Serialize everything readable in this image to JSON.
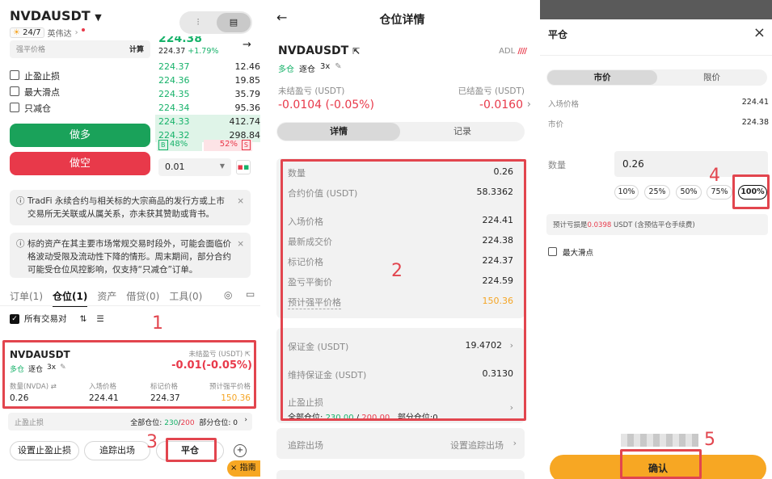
{
  "annotations": [
    "1",
    "2",
    "3",
    "4",
    "5"
  ],
  "panel1": {
    "symbol": "NVDAUSDT",
    "badge_247": "24/7",
    "underlying": "英伟达",
    "price_big": "224.38",
    "price_sub": "224.37",
    "price_pct": "+1.79%",
    "force_price_label": "强平价格",
    "calc_label": "计算",
    "checkboxes": [
      "止盈止损",
      "最大滑点",
      "只减仓"
    ],
    "buy_button": "做多",
    "sell_button": "做空",
    "orderbook": [
      {
        "price": "224.37",
        "qty": "12.46"
      },
      {
        "price": "224.36",
        "qty": "19.85"
      },
      {
        "price": "224.35",
        "qty": "35.79"
      },
      {
        "price": "224.34",
        "qty": "95.36"
      },
      {
        "price": "224.33",
        "qty": "412.74"
      },
      {
        "price": "224.32",
        "qty": "298.84"
      }
    ],
    "buy_ratio_tag": "B",
    "buy_ratio": "48%",
    "sell_ratio": "52%",
    "sell_ratio_tag": "S",
    "precision": "0.01",
    "notice1": "TradFi 永续合约与相关标的大宗商品的发行方或上市交易所无关联或从属关系，亦未获其赞助或背书。",
    "notice2": "标的资产在其主要市场常规交易时段外，可能会面临价格波动受限及流动性下降的情形。周末期间，部分合约可能受仓位风控影响，仅支持“只减仓”订单。",
    "tabs": [
      "订单(1)",
      "仓位(1)",
      "资产",
      "借贷(0)",
      "工具(0)"
    ],
    "all_pairs": "所有交易对",
    "position": {
      "symbol": "NVDAUSDT",
      "side": "多仓",
      "mode": "逐仓",
      "leverage": "3x",
      "unrealized_label": "未结盈亏 (USDT)",
      "unrealized": "-0.01(-0.05%)",
      "col_labels": [
        "数量(NVDA)",
        "入场价格",
        "标记价格",
        "预计强平价格"
      ],
      "col_values": [
        "0.26",
        "224.41",
        "224.37",
        "150.36"
      ]
    },
    "tpsl_label": "止盈止损",
    "tpsl_all_label": "全部仓位:",
    "tpsl_all_green": "230",
    "tpsl_all_red": "200",
    "tpsl_part": "部分仓位: 0",
    "btn_set_tpsl": "设置止盈止损",
    "btn_trailing": "追踪出场",
    "btn_close": "平仓",
    "guide": "指南"
  },
  "panel2": {
    "title": "仓位详情",
    "symbol": "NVDAUSDT",
    "adl_label": "ADL",
    "side": "多仓",
    "mode": "逐仓",
    "leverage": "3x",
    "unrealized_label": "未结盈亏 (USDT)",
    "unrealized": "-0.0104 (-0.05%)",
    "realized_label": "已结盈亏 (USDT)",
    "realized": "-0.0160",
    "tabs": [
      "详情",
      "记录"
    ],
    "rows": [
      {
        "label": "数量",
        "value": "0.26"
      },
      {
        "label": "合约价值 (USDT)",
        "value": "58.3362"
      },
      {
        "label": "入场价格",
        "value": "224.41"
      },
      {
        "label": "最新成交价",
        "value": "224.38"
      },
      {
        "label": "标记价格",
        "value": "224.37"
      },
      {
        "label": "盈亏平衡价",
        "value": "224.59"
      },
      {
        "label": "预计强平价格",
        "value": "150.36"
      }
    ],
    "margin_label": "保证金 (USDT)",
    "margin_value": "19.4702",
    "maint_label": "维持保证金 (USDT)",
    "maint_value": "0.3130",
    "tpsl_label": "止盈止损",
    "tpsl_all_label": "全部仓位:",
    "tpsl_all_green": "230.00",
    "tpsl_all_red": "200.00",
    "tpsl_part": "部分仓位:0",
    "trailing_label": "追踪出场",
    "trailing_action": "设置追踪出场"
  },
  "panel3": {
    "title": "平仓",
    "tabs": [
      "市价",
      "限价"
    ],
    "entry_label": "入场价格",
    "entry_value": "224.41",
    "market_label": "市价",
    "market_value": "224.38",
    "qty_label": "数量",
    "qty_value": "0.26",
    "percents": [
      "10%",
      "25%",
      "50%",
      "75%",
      "100%"
    ],
    "estimate_prefix": "预计亏损是",
    "estimate_value": "0.0398",
    "estimate_suffix": "USDT (含预估平仓手续费)",
    "slippage_label": "最大滑点",
    "confirm": "确认"
  },
  "colors": {
    "green": "#17b26a",
    "red": "#e8394a",
    "orange": "#f5a524",
    "highlight": "#e2454e"
  }
}
